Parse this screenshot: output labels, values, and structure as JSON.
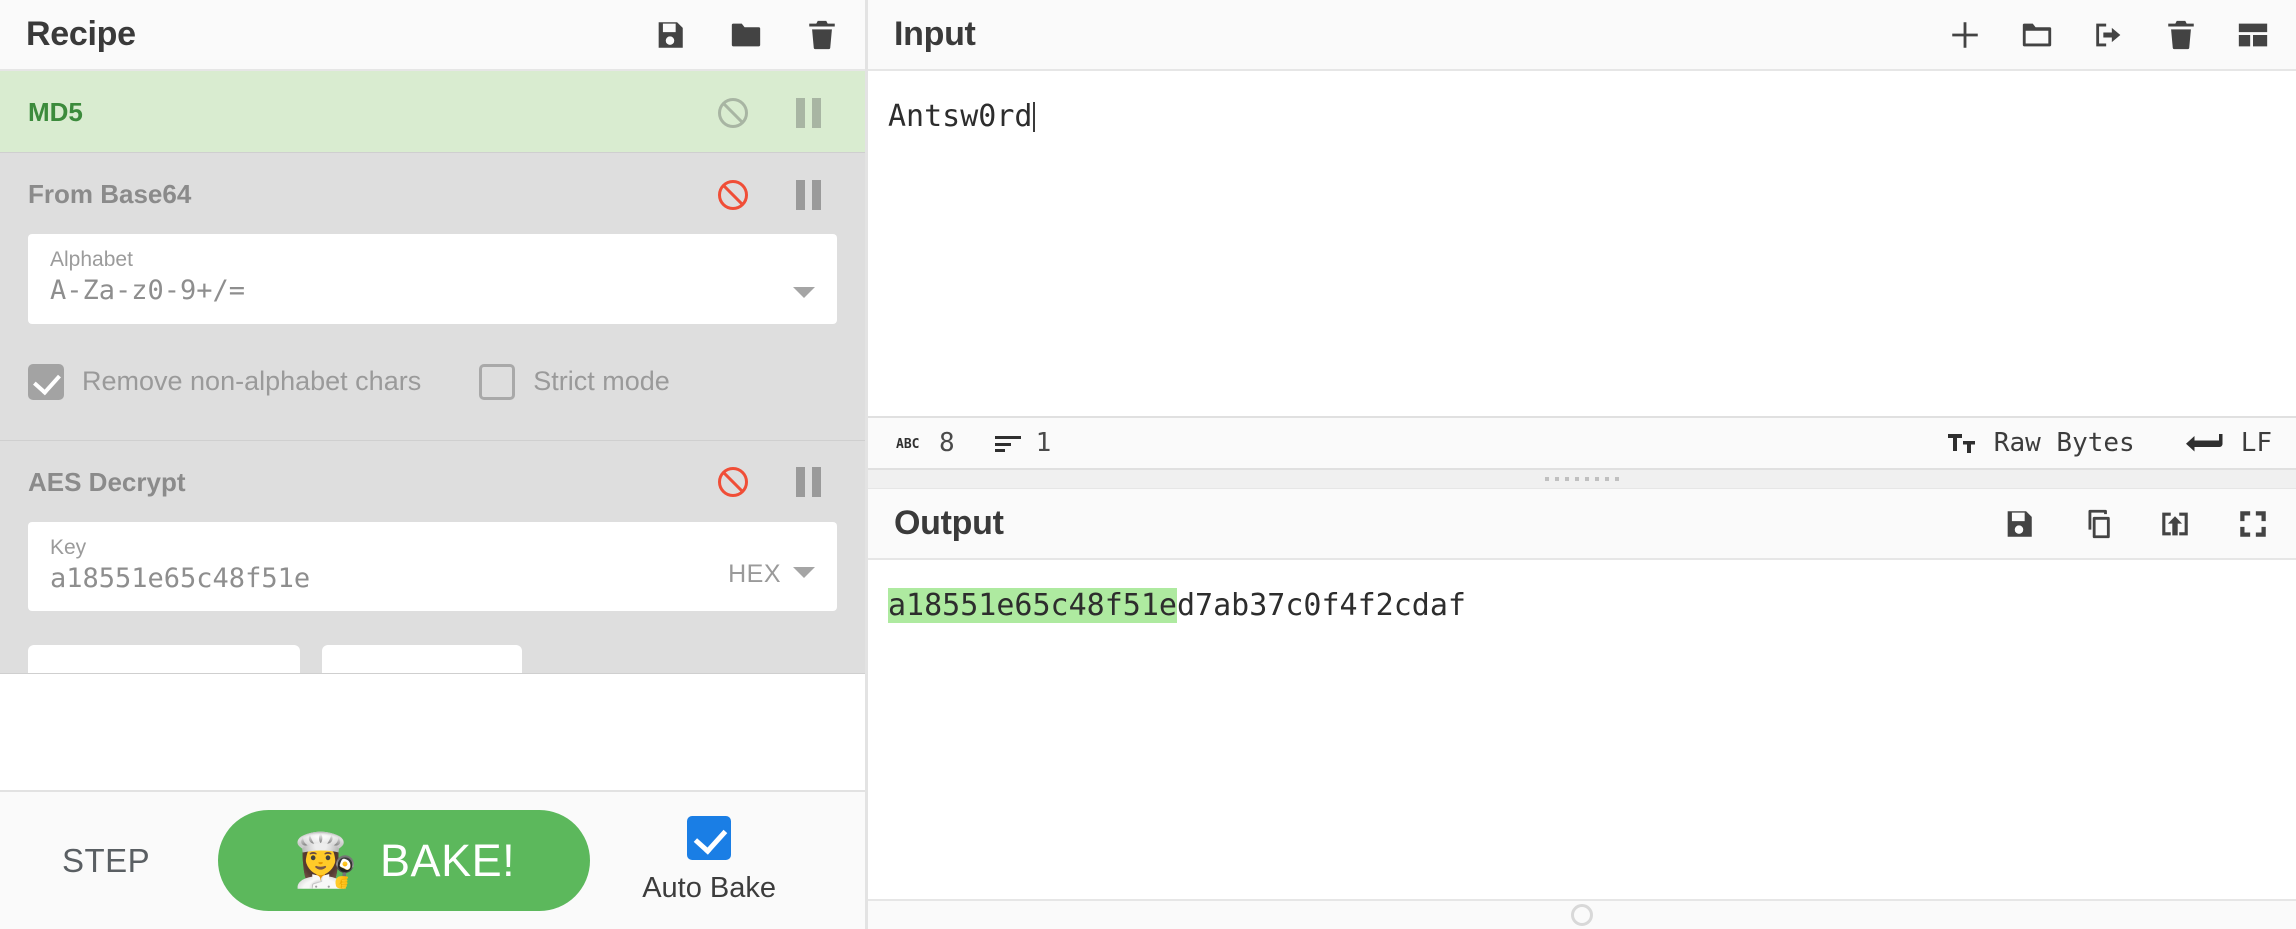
{
  "recipe": {
    "title": "Recipe",
    "toolbar": [
      {
        "name": "save-recipe-icon",
        "label": "Save recipe"
      },
      {
        "name": "load-recipe-icon",
        "label": "Load recipe"
      },
      {
        "name": "clear-recipe-icon",
        "label": "Clear recipe"
      }
    ],
    "operations": [
      {
        "name": "MD5",
        "state": "active",
        "disable_label": "Disable operation",
        "breakpoint_label": "Set breakpoint",
        "args": []
      },
      {
        "name": "From Base64",
        "state": "inactive",
        "disable_label": "Disable operation",
        "breakpoint_label": "Set breakpoint",
        "args": [
          {
            "type": "select",
            "label": "Alphabet",
            "value": "A-Za-z0-9+/="
          }
        ],
        "checkboxes": [
          {
            "label": "Remove non-alphabet chars",
            "checked": true
          },
          {
            "label": "Strict mode",
            "checked": false
          }
        ]
      },
      {
        "name": "AES Decrypt",
        "state": "inactive",
        "disable_label": "Disable operation",
        "breakpoint_label": "Set breakpoint",
        "args": [
          {
            "type": "text",
            "label": "Key",
            "value": "a18551e65c48f51e",
            "unit": "HEX"
          }
        ]
      }
    ],
    "controls": {
      "step_label": "STEP",
      "bake_label": "BAKE!",
      "bake_icon": "👩‍🍳",
      "auto_bake_label": "Auto Bake",
      "auto_bake_checked": true,
      "bake_color": "#5cb85c",
      "auto_bake_color": "#1a7ee5"
    }
  },
  "input": {
    "title": "Input",
    "value": "Antsw0rd",
    "toolbar": [
      {
        "name": "add-input-tab-icon",
        "label": "Add a new input tab"
      },
      {
        "name": "open-folder-icon",
        "label": "Open file as input"
      },
      {
        "name": "open-folder-input-icon",
        "label": "Open folder as input"
      },
      {
        "name": "clear-input-icon",
        "label": "Clear input and output"
      },
      {
        "name": "reset-pane-layout-icon",
        "label": "Reset pane layout"
      }
    ],
    "status": {
      "length_icon": "ABC",
      "length": "8",
      "lines_icon": "lines-icon",
      "lines": "1",
      "char_enc_icon": "Tt",
      "char_enc": "Raw Bytes",
      "line_ending_icon": "return-arrow-icon",
      "line_ending": "LF"
    }
  },
  "output": {
    "title": "Output",
    "value_highlighted": "a18551e65c48f51e",
    "value_rest": "d7ab37c0f4f2cdaf",
    "highlight_color": "#aeeaa0",
    "toolbar": [
      {
        "name": "save-output-icon",
        "label": "Save output to file"
      },
      {
        "name": "copy-output-icon",
        "label": "Copy raw output to the clipboard"
      },
      {
        "name": "replace-input-icon",
        "label": "Replace input with output"
      },
      {
        "name": "maximise-output-icon",
        "label": "Maximise output pane"
      }
    ]
  }
}
